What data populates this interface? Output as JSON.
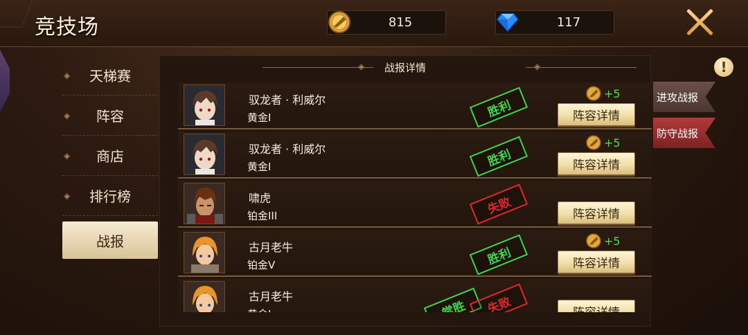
{
  "header": {
    "title": "竞技场",
    "gold": "815",
    "diamond": "117"
  },
  "nav": {
    "items": [
      {
        "label": "天梯赛",
        "active": false
      },
      {
        "label": "阵容",
        "active": false
      },
      {
        "label": "商店",
        "active": false
      },
      {
        "label": "排行榜",
        "active": false
      },
      {
        "label": "战报",
        "active": true
      }
    ]
  },
  "panel": {
    "title": "战报详情",
    "detail_label": "阵容详情",
    "rows": [
      {
        "name": "驭龙者 · 利威尔",
        "rank": "黄金I",
        "result": "胜利",
        "reward": "+5"
      },
      {
        "name": "驭龙者 · 利威尔",
        "rank": "黄金I",
        "result": "胜利",
        "reward": "+5"
      },
      {
        "name": "啸虎",
        "rank": "铂金III",
        "result": "失败",
        "reward": ""
      },
      {
        "name": "古月老牛",
        "rank": "铂金V",
        "result": "胜利",
        "reward": "+5"
      },
      {
        "name": "古月老牛",
        "rank": "黄金I",
        "result": "失败",
        "extra_stamp": "常胜",
        "reward": ""
      }
    ]
  },
  "side_tabs": {
    "attack": "进攻战报",
    "defend": "防守战报"
  },
  "colors": {
    "win": "#3fd84a",
    "lose": "#e02a2a",
    "reward": "#49e04a"
  },
  "icons": [
    "gold-coin-icon",
    "diamond-icon",
    "close-icon",
    "info-icon"
  ]
}
